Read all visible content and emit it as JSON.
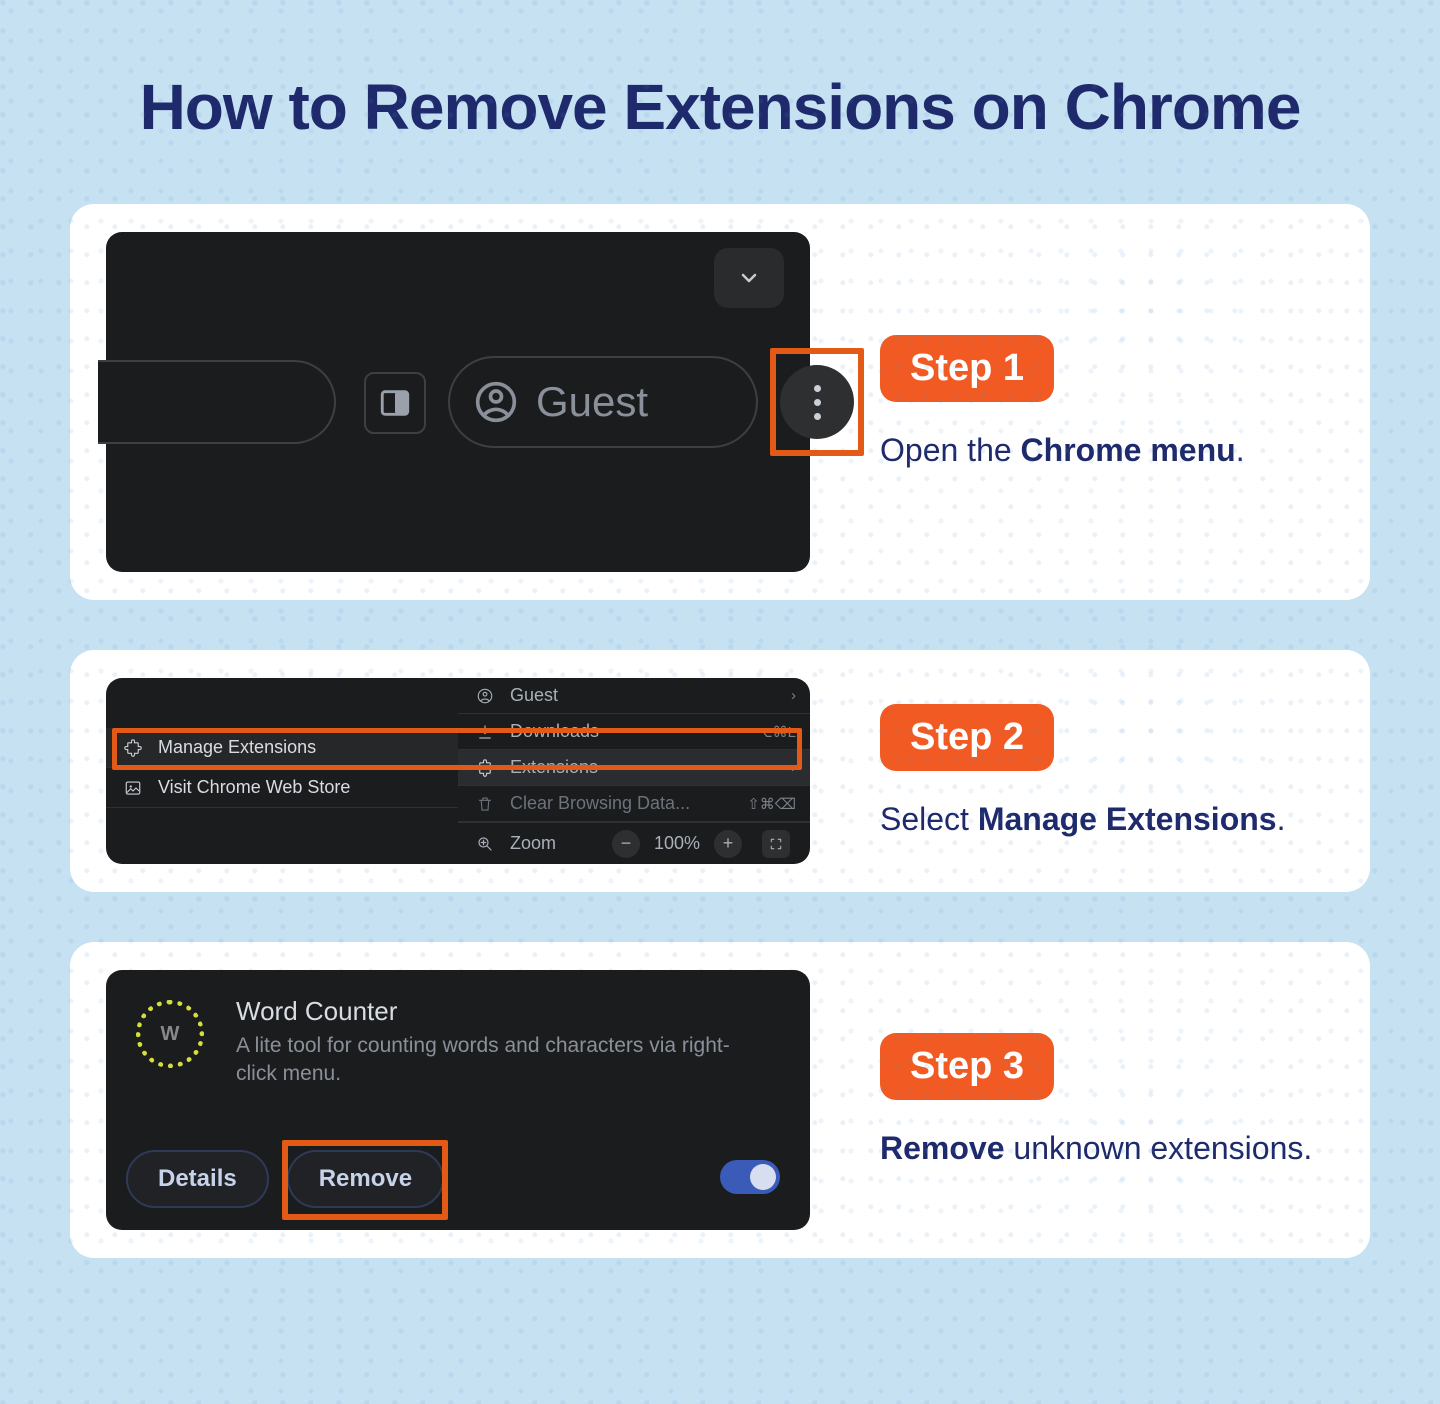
{
  "title": "How to Remove Extensions on Chrome",
  "steps": {
    "s1": {
      "badge": "Step 1",
      "desc_pre": "Open the ",
      "desc_bold": "Chrome menu",
      "desc_post": "."
    },
    "s2": {
      "badge": "Step 2",
      "desc_pre": "Select ",
      "desc_bold": "Manage Extensions",
      "desc_post": "."
    },
    "s3": {
      "badge": "Step 3",
      "desc_bold": "Remove",
      "desc_post": " unknown extensions."
    }
  },
  "shot1": {
    "guest": "Guest"
  },
  "shot2": {
    "left": {
      "manage": "Manage Extensions",
      "store": "Visit Chrome Web Store"
    },
    "right": {
      "guest": "Guest",
      "downloads": "Downloads",
      "downloads_sc": "⌥⌘L",
      "extensions": "Extensions",
      "clear": "Clear Browsing Data...",
      "clear_sc": "⇧⌘⌫",
      "zoom": "Zoom",
      "zoom_pct": "100%"
    }
  },
  "shot3": {
    "icon_letter": "W",
    "title": "Word Counter",
    "desc": "A lite tool for counting words and characters via right-click menu.",
    "details": "Details",
    "remove": "Remove"
  }
}
